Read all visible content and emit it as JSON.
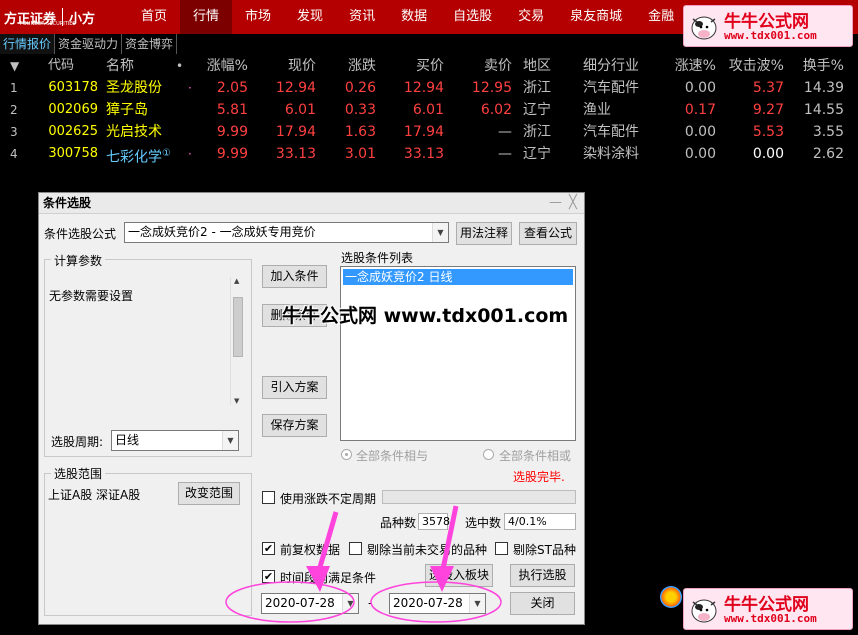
{
  "brand": {
    "logo": "方正证券",
    "sub": "FOUNDER SECURITIES",
    "small": "小方"
  },
  "nav": [
    "首页",
    "行情",
    "市场",
    "发现",
    "资讯",
    "数据",
    "自选股",
    "交易",
    "泉友商城",
    "金融"
  ],
  "nav_active": 1,
  "subtabs": [
    "行情报价",
    "资金驱动力",
    "资金博弈"
  ],
  "grid": {
    "headers": {
      "code": "代码",
      "name": "名称",
      "dot": "•",
      "pct": "涨幅%",
      "price": "现价",
      "chg": "涨跌",
      "buy": "买价",
      "sell": "卖价",
      "region": "地区",
      "ind": "细分行业",
      "speed": "涨速%",
      "attack": "攻击波%",
      "turn": "换手%"
    },
    "rows": [
      {
        "idx": "1",
        "code": "603178",
        "name": "圣龙股份",
        "dot": "·",
        "pct": "2.05",
        "price": "12.94",
        "chg": "0.26",
        "buy": "12.94",
        "sell": "12.95",
        "region": "浙江",
        "ind": "汽车配件",
        "speed": "0.00",
        "attack": "5.37",
        "turn": "14.39"
      },
      {
        "idx": "2",
        "code": "002069",
        "name": "獐子岛",
        "dot": "",
        "pct": "5.81",
        "price": "6.01",
        "chg": "0.33",
        "buy": "6.01",
        "sell": "6.02",
        "region": "辽宁",
        "ind": "渔业",
        "speed": "0.17",
        "attack": "9.27",
        "turn": "14.55"
      },
      {
        "idx": "3",
        "code": "002625",
        "name": "光启技术",
        "dot": "",
        "pct": "9.99",
        "price": "17.94",
        "chg": "1.63",
        "buy": "17.94",
        "sell": "—",
        "region": "浙江",
        "ind": "汽车配件",
        "speed": "0.00",
        "attack": "5.53",
        "turn": "3.55"
      },
      {
        "idx": "4",
        "code": "300758",
        "name": "七彩化学",
        "sup": "①",
        "dot": "·",
        "pct": "9.99",
        "price": "33.13",
        "chg": "3.01",
        "buy": "33.13",
        "sell": "—",
        "region": "辽宁",
        "ind": "染料涂料",
        "speed": "0.00",
        "attack": "0.00",
        "turn": "2.62"
      }
    ]
  },
  "dialog": {
    "title": "条件选股",
    "controls": {
      "min": "—",
      "close": "╳"
    },
    "formula_label": "条件选股公式",
    "formula_value": "一念成妖竞价2 - 一念成妖专用竞价",
    "btn_usage": "用法注释",
    "btn_view": "查看公式",
    "params_group": "计算参数",
    "params_text": "无参数需要设置",
    "period_label": "选股周期:",
    "period_value": "日线",
    "scope_group": "选股范围",
    "scope_text": "上证A股 深证A股",
    "btn_scope": "改变范围",
    "btn_add": "加入条件",
    "btn_delete": "删除条件",
    "btn_import": "引入方案",
    "btn_save": "保存方案",
    "list_label": "选股条件列表",
    "list_items": [
      "一念成妖竞价2  日线"
    ],
    "radio_and": "全部条件相与",
    "radio_or": "全部条件相或",
    "status": "选股完毕.",
    "uncertain_period": "使用涨跌不定周期",
    "count_label": "品种数",
    "count_value": "3578",
    "hit_label": "选中数",
    "hit_value": "4/0.1%",
    "chk_prefix": "前复权数据",
    "chk_exclude_untraded": "剔除当前未交易的品种",
    "chk_exclude_st": "剔除ST品种",
    "chk_time_range": "时间段内满足条件",
    "btn_to_board": "选股入板块",
    "btn_execute": "执行选股",
    "btn_close": "关闭",
    "date_from": "2020-07-28",
    "date_sep": "-",
    "date_to": "2020-07-28"
  },
  "watermark": {
    "center": "牛牛公式网  www.tdx001.com",
    "badge_title": "牛牛公式网",
    "badge_url": "www.tdx001.com"
  },
  "colors": {
    "nav_bg": "#b40000",
    "up": "#ff4040",
    "code": "#ffff00",
    "highlight": "#ff44cc",
    "annotation": "#ff44dd"
  }
}
